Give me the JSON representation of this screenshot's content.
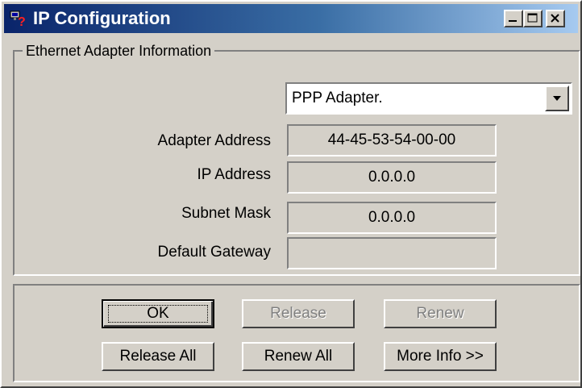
{
  "window": {
    "title": "IP Configuration",
    "controls": {
      "minimize": "minimize-icon",
      "maximize": "maximize-icon",
      "close": "close-icon"
    }
  },
  "group": {
    "label": "Ethernet  Adapter Information"
  },
  "adapter_select": {
    "selected": "PPP Adapter."
  },
  "fields": [
    {
      "label": "Adapter Address",
      "value": "44-45-53-54-00-00"
    },
    {
      "label": "IP Address",
      "value": "0.0.0.0"
    },
    {
      "label": "Subnet Mask",
      "value": "0.0.0.0"
    },
    {
      "label": "Default Gateway",
      "value": ""
    }
  ],
  "buttons": {
    "ok": "OK",
    "release": "Release",
    "renew": "Renew",
    "release_all": "Release All",
    "renew_all": "Renew All",
    "more_info": "More Info >>"
  },
  "colors": {
    "title_bar_start": "#0a246a",
    "title_bar_end": "#a6caf0",
    "face": "#d4d0c8"
  }
}
